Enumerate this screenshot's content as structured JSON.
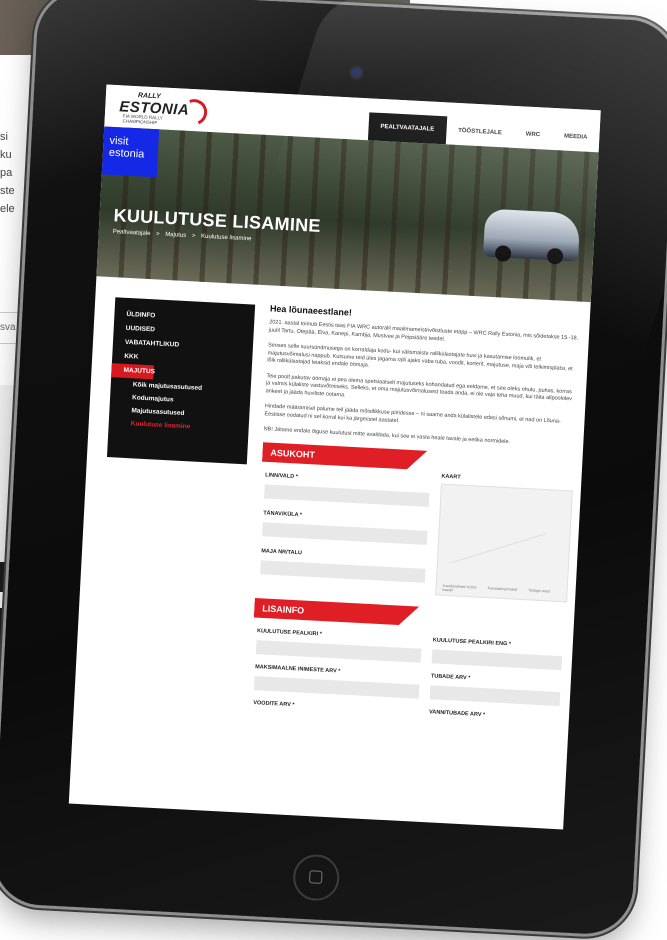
{
  "background_page": {
    "text_lines": [
      "si",
      "ku",
      "pa",
      "ste",
      "ele"
    ],
    "input_fragment": "sva",
    "button_label": "A"
  },
  "site": {
    "logo": {
      "rally": "RALLY",
      "estonia": "ESTONIA",
      "sub": "FIA WORLD RALLY CHAMPIONSHIP"
    },
    "nav": [
      "PEALTVAATAJALE",
      "TÖÖSTLEJALE",
      "WRC",
      "MEEDIA"
    ],
    "visit_badge": [
      "visit",
      "estonia"
    ],
    "hero_title": "KUULUTUSE LISAMINE",
    "breadcrumb": [
      "Pealtvaatajale",
      ">",
      "Majutus",
      ">",
      "Kuulutuse lisamine"
    ]
  },
  "sidebar": {
    "items": [
      "ÜLDINFO",
      "UUDISED",
      "VABATAHTLIKUD",
      "KKK",
      "MAJUTUS"
    ],
    "subitems": [
      "Kõik majutusasutused",
      "Kodumajutus",
      "Majutusasutused",
      "Kuulutuse lisamine"
    ]
  },
  "content": {
    "greeting": "Hea lõunaeestlane!",
    "paragraphs": [
      "2021. aastal toimub Eestis taas FIA WRC autoralli maailmameistrivõistluste etapp – WRC Rally Estonia, mis sõidetakse 15.-18. juulil Tartu, Otepää, Elva, Kanepi, Kambja, Mustvee ja Peipsiääre teedel.",
      "Seoses selle suursündmusega on korraldaja kodu- kui välismaiste rallikülastajate huvi ja kasutamise loomulik, et majutusvõimalusi nappub. Kutsume teid üles jagama ralli ajaks vaba tuba, voodit, korterit, majutuse, maja või telkimisplatsi, et lõik rallikülastajad leiaksid endale öömaja.",
      "Teie poolt pakutav öömaja ei pea olema spetsiaalselt majutuseks kohandatud ega eeldame, et see oleks ohutu, puhas, korras ja valmis külaliste vastuvõtmiseks. Selleks, et oma majutusvõimalusest teada anda, ei ole vaja teha muud, kui täita allpoololev ankeet ja jääda huviliste ootama.",
      "Hindade määramisel palume teil jääda mõistlikkuse piiridesse – ni saame anda külalistele edasi sõnumi, et nad on Lõuna-Eestisse oodatud ni sel korral kui ka järgmistel aastatel.",
      "NB! Jätame endale õiguse kuulutust mitte avaldada, kui see ei vasta heale tavale ja eetika normidele."
    ],
    "asukoht": {
      "title": "ASUKOHT",
      "linn_label": "LINN/VALD *",
      "tanav_label": "TÄNAV/KÜLA *",
      "maja_label": "MAJA NR/TALU",
      "kaart_label": "KAART",
      "map_footer": [
        "Kaardiandmed ©2021",
        "Kasutustingimused",
        "Teatage veast kaardil"
      ]
    },
    "lisainfo": {
      "title": "LISAINFO",
      "pealkiri_label": "KUULUTUSE PEALKIRI *",
      "pealkiri_eng_label": "KUULUTUSE PEALKIRI ENG *",
      "inimesi_label": "MAKSIMAALNE INIMESTE ARV *",
      "tubade_label": "TUBADE ARV *",
      "voodite_label": "VOODITE ARV *",
      "vannitubade_label": "VANNITUBADE ARV *"
    }
  },
  "colors": {
    "accent": "#e01e26",
    "badge_blue": "#1428e6",
    "sidebar_bg": "#111111"
  }
}
